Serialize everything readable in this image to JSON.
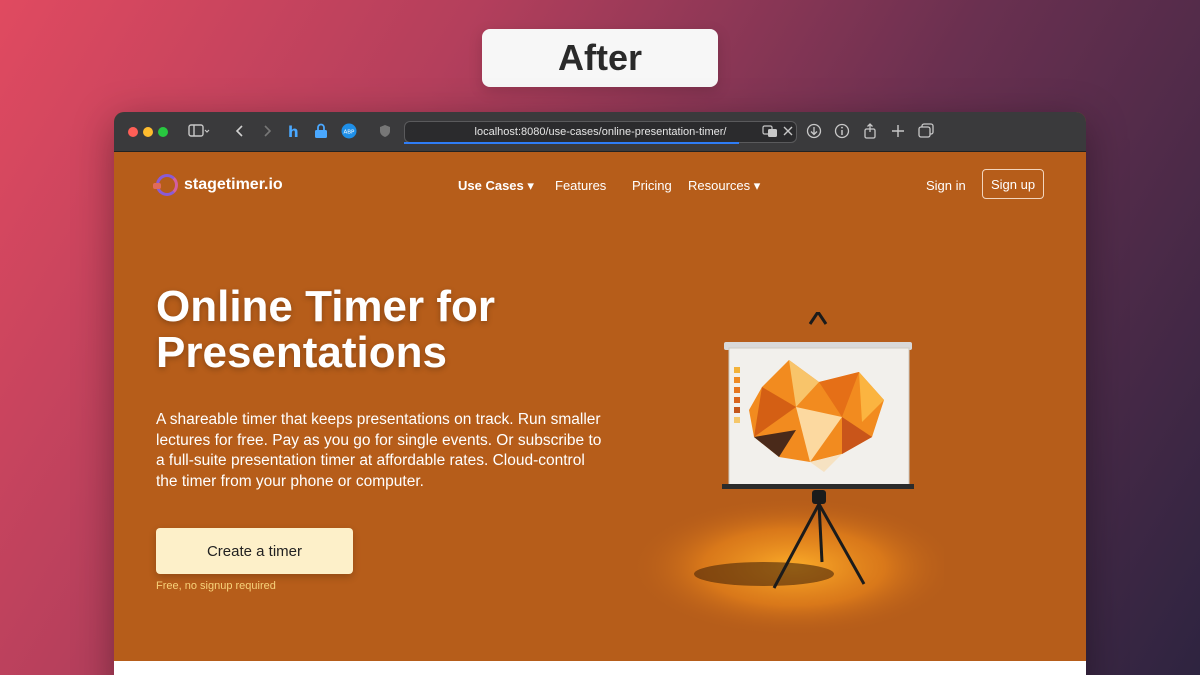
{
  "overlay": {
    "label": "After"
  },
  "browser": {
    "url": "localhost:8080/use-cases/online-presentation-timer/"
  },
  "site": {
    "logo_text": "stagetimer.io",
    "nav": [
      {
        "label": "Use Cases ▾"
      },
      {
        "label": "Features"
      },
      {
        "label": "Pricing"
      },
      {
        "label": "Resources ▾"
      }
    ],
    "sign_in": "Sign in",
    "sign_up": "Sign up"
  },
  "hero": {
    "title": "Online Timer for Presentations",
    "description": "A shareable timer that keeps presentations on track. Run smaller lectures for free. Pay as you go for single events. Or subscribe to a full-suite presentation timer at affordable rates. Cloud-control the timer from your phone or computer.",
    "cta": "Create a timer",
    "cta_note": "Free, no signup required"
  },
  "colors": {
    "page_bg": "#b65d1a",
    "cta_bg": "#fdf0c9",
    "cta_note": "#f7d27a",
    "url_focus": "#2f7df6"
  },
  "icons": [
    "sidebar-icon",
    "back-icon",
    "forward-icon",
    "honey-icon",
    "lock-icon",
    "adblock-icon",
    "shield-icon",
    "translate-icon",
    "close-icon",
    "download-icon",
    "info-icon",
    "share-icon",
    "new-tab-icon",
    "tabs-icon"
  ]
}
